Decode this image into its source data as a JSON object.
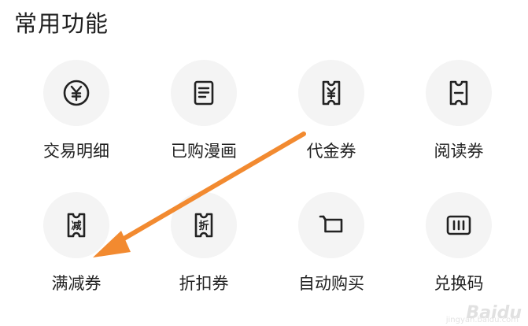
{
  "section": {
    "title": "常用功能"
  },
  "functions": [
    {
      "label": "交易明细",
      "icon": "yen-circle-icon"
    },
    {
      "label": "已购漫画",
      "icon": "document-list-icon"
    },
    {
      "label": "代金券",
      "icon": "yen-ticket-icon"
    },
    {
      "label": "阅读券",
      "icon": "ticket-icon"
    },
    {
      "label": "满减券",
      "icon": "discount-ticket-icon",
      "icon_char": "减"
    },
    {
      "label": "折扣券",
      "icon": "discount-ticket-icon",
      "icon_char": "折"
    },
    {
      "label": "自动购买",
      "icon": "cart-icon"
    },
    {
      "label": "兑换码",
      "icon": "code-card-icon"
    }
  ],
  "annotation": {
    "arrow_color": "#f28a30"
  },
  "watermark": {
    "text": "Baidu",
    "sub": "jingyan.baidu.com"
  }
}
